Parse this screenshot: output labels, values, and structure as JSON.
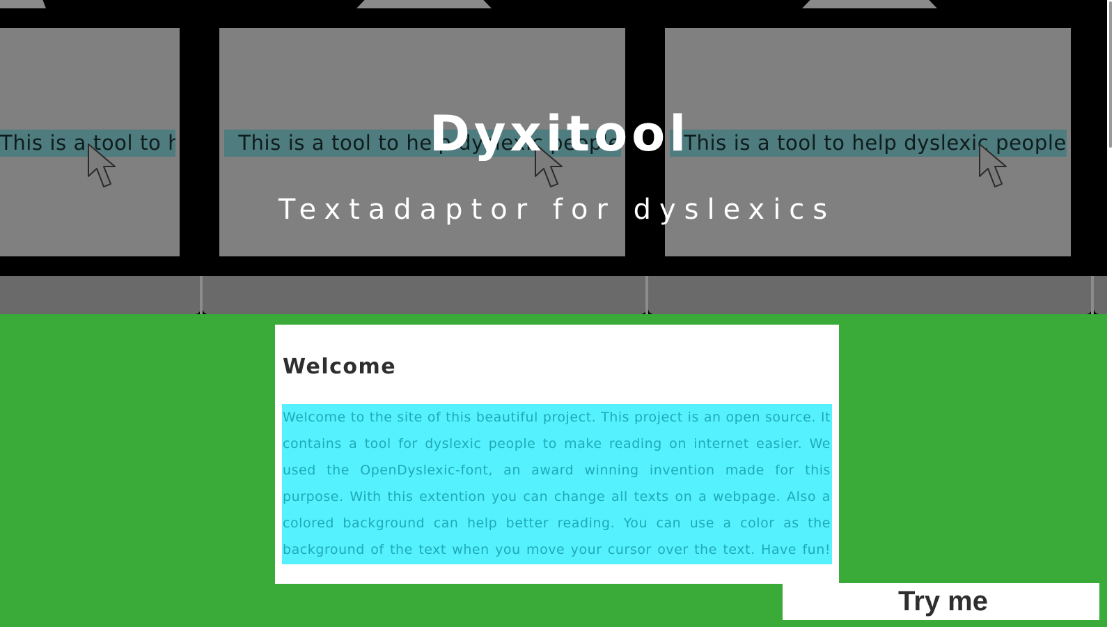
{
  "hero": {
    "title": "Dyxitool",
    "subtitle": "Textadaptor for dyslexics",
    "slides": [
      {
        "caption": "This is a tool to help dyslexic people",
        "icon": "cursor-arrow-icon"
      },
      {
        "caption": "This is a tool to help dyslexic people",
        "icon": "cursor-arrow-icon"
      },
      {
        "caption": "This is a tool to help dyslexic people",
        "icon": "cursor-arrow-icon"
      }
    ]
  },
  "welcome": {
    "heading": "Welcome",
    "text": "Welcome to the site of this beautiful project. This project is an open source. It contains a tool for dyslexic people to make reading on internet easier. We used the OpenDyslexic-font, an award winning invention made for this purpose. With this extention you can change all texts on a webpage. Also a colored background can help better reading. You can use a color as the background of the text when you move your cursor over the text. Have fun!"
  },
  "cta": {
    "label": "Try me"
  },
  "colors": {
    "page_background": "#3aaa38",
    "hero_background": "#000000",
    "highlight": "#55f1ff",
    "highlight_text": "#1faab6"
  }
}
